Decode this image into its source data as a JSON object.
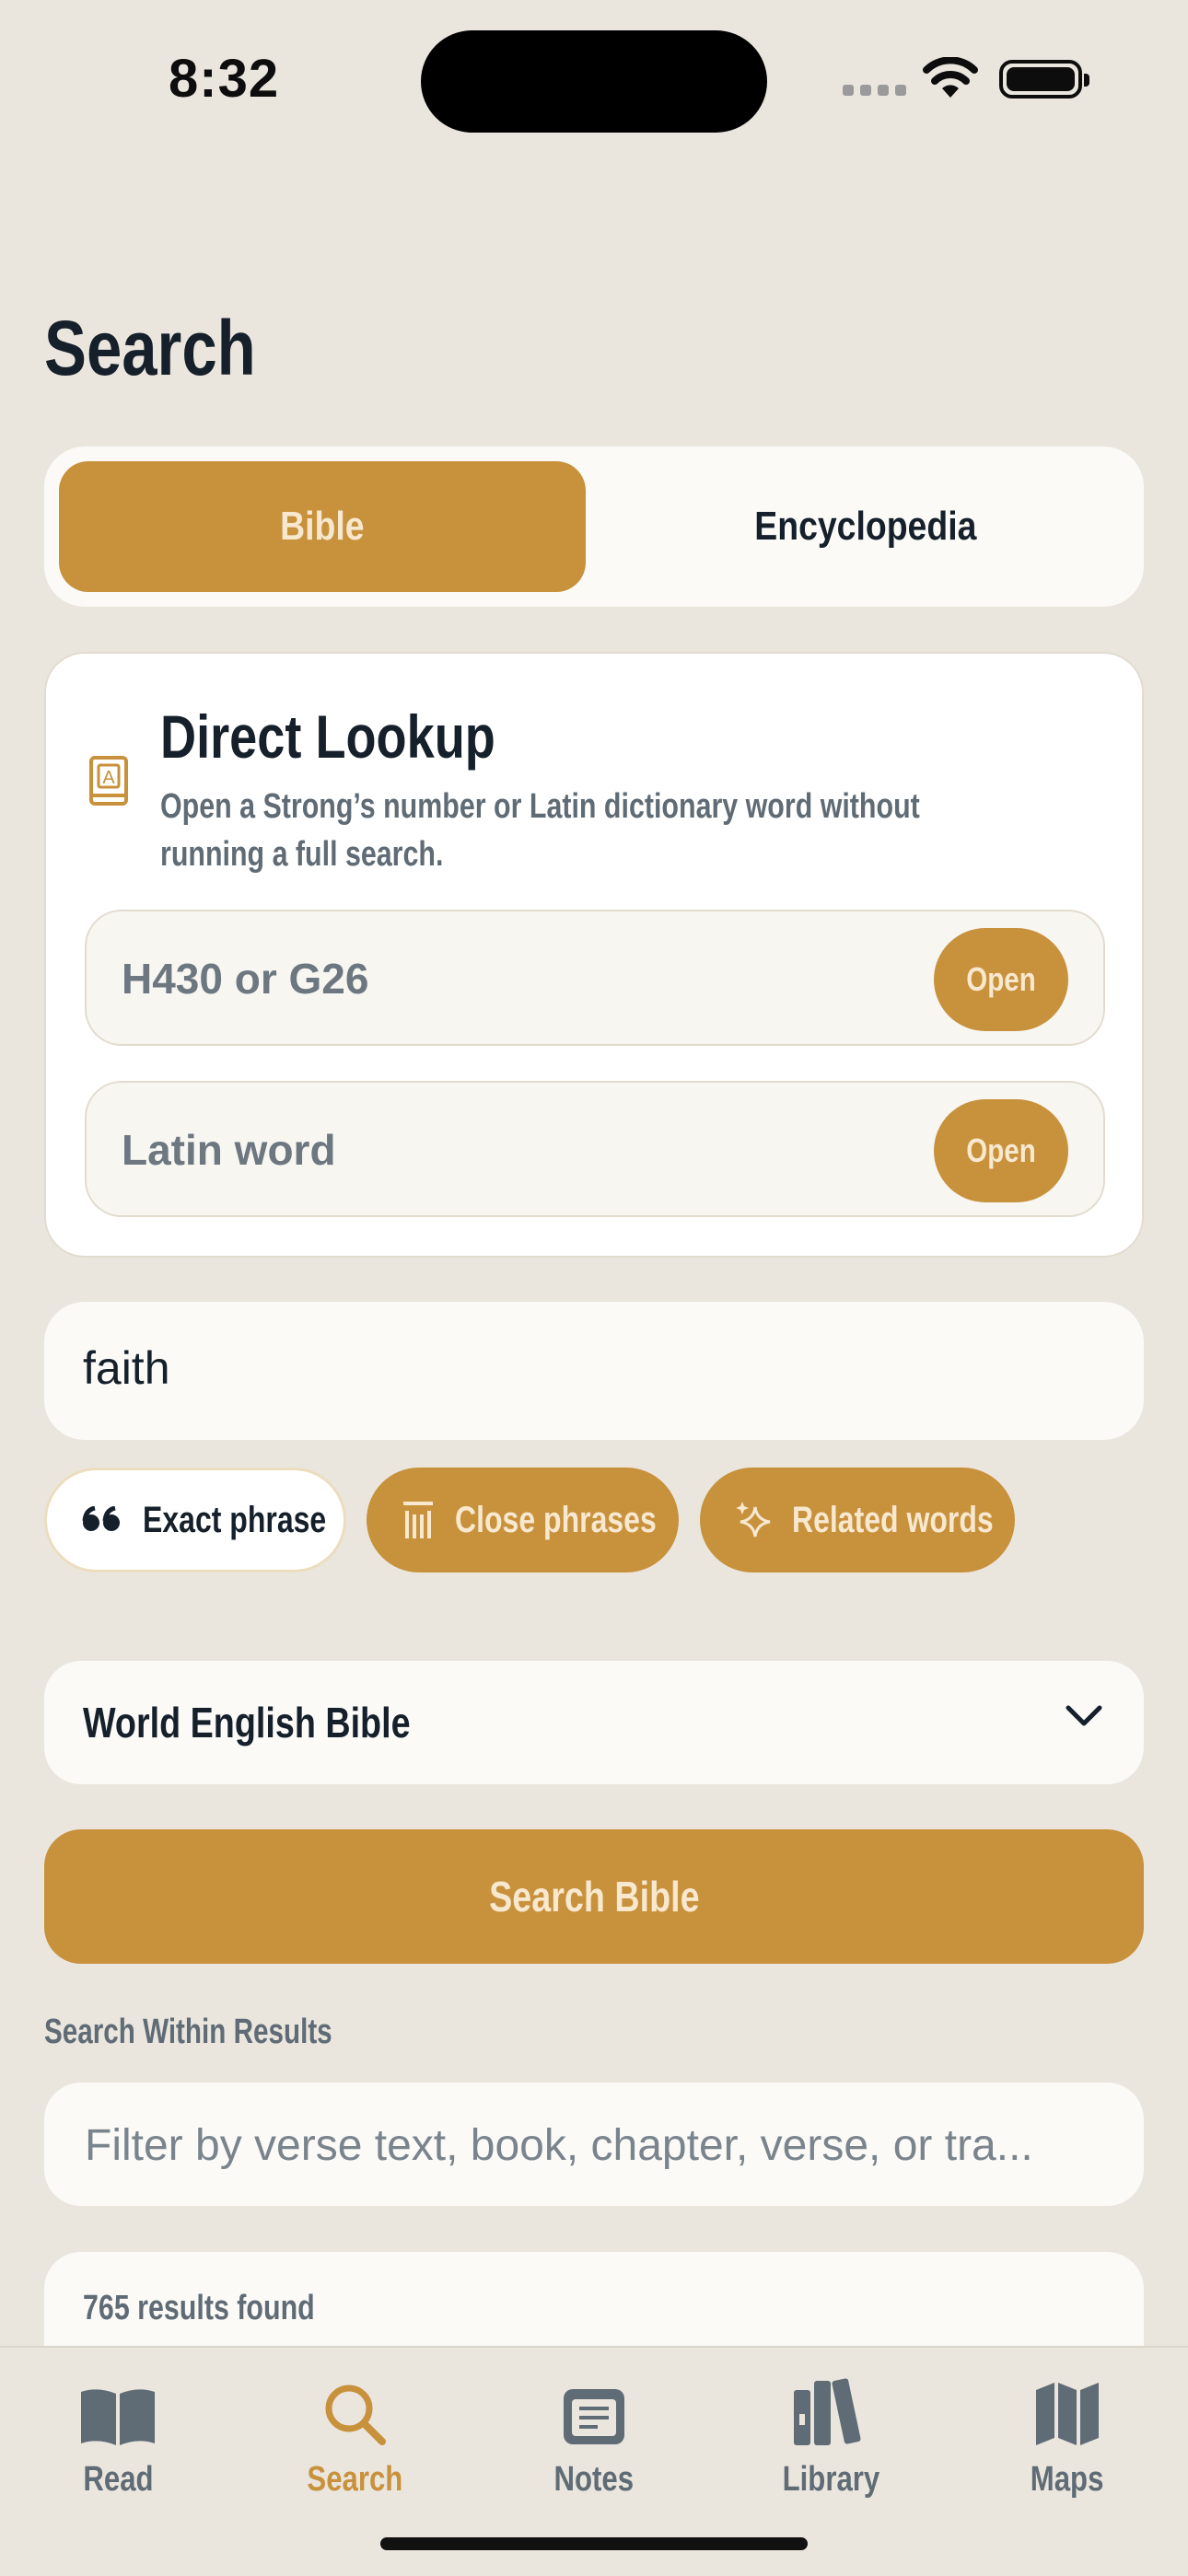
{
  "status": {
    "time": "8:32"
  },
  "page": {
    "title": "Search"
  },
  "segment": {
    "bible": "Bible",
    "encyclopedia": "Encyclopedia",
    "selected": "Bible"
  },
  "lookup": {
    "title": "Direct Lookup",
    "subtitle": "Open a Strong’s number or Latin dictionary word without running a full search.",
    "strongs_placeholder": "H430 or G26",
    "latin_placeholder": "Latin word",
    "open_label": "Open"
  },
  "search": {
    "query": "faith"
  },
  "chips": {
    "exact": "Exact phrase",
    "close": "Close phrases",
    "related": "Related words"
  },
  "translation": {
    "selected": "World English Bible"
  },
  "search_button": "Search Bible",
  "within": {
    "label": "Search Within Results",
    "placeholder": "Filter by verse text, book, chapter, verse, or tra..."
  },
  "results": {
    "count_text": "765 results found"
  },
  "tabs": [
    {
      "label": "Read",
      "icon": "book-open-icon"
    },
    {
      "label": "Search",
      "icon": "magnifier-icon",
      "active": true
    },
    {
      "label": "Notes",
      "icon": "note-icon"
    },
    {
      "label": "Library",
      "icon": "library-icon"
    },
    {
      "label": "Maps",
      "icon": "map-icon"
    }
  ],
  "colors": {
    "accent": "#C8913C",
    "background": "#EAE6DE",
    "text": "#15202B",
    "muted": "#5F6B75"
  }
}
